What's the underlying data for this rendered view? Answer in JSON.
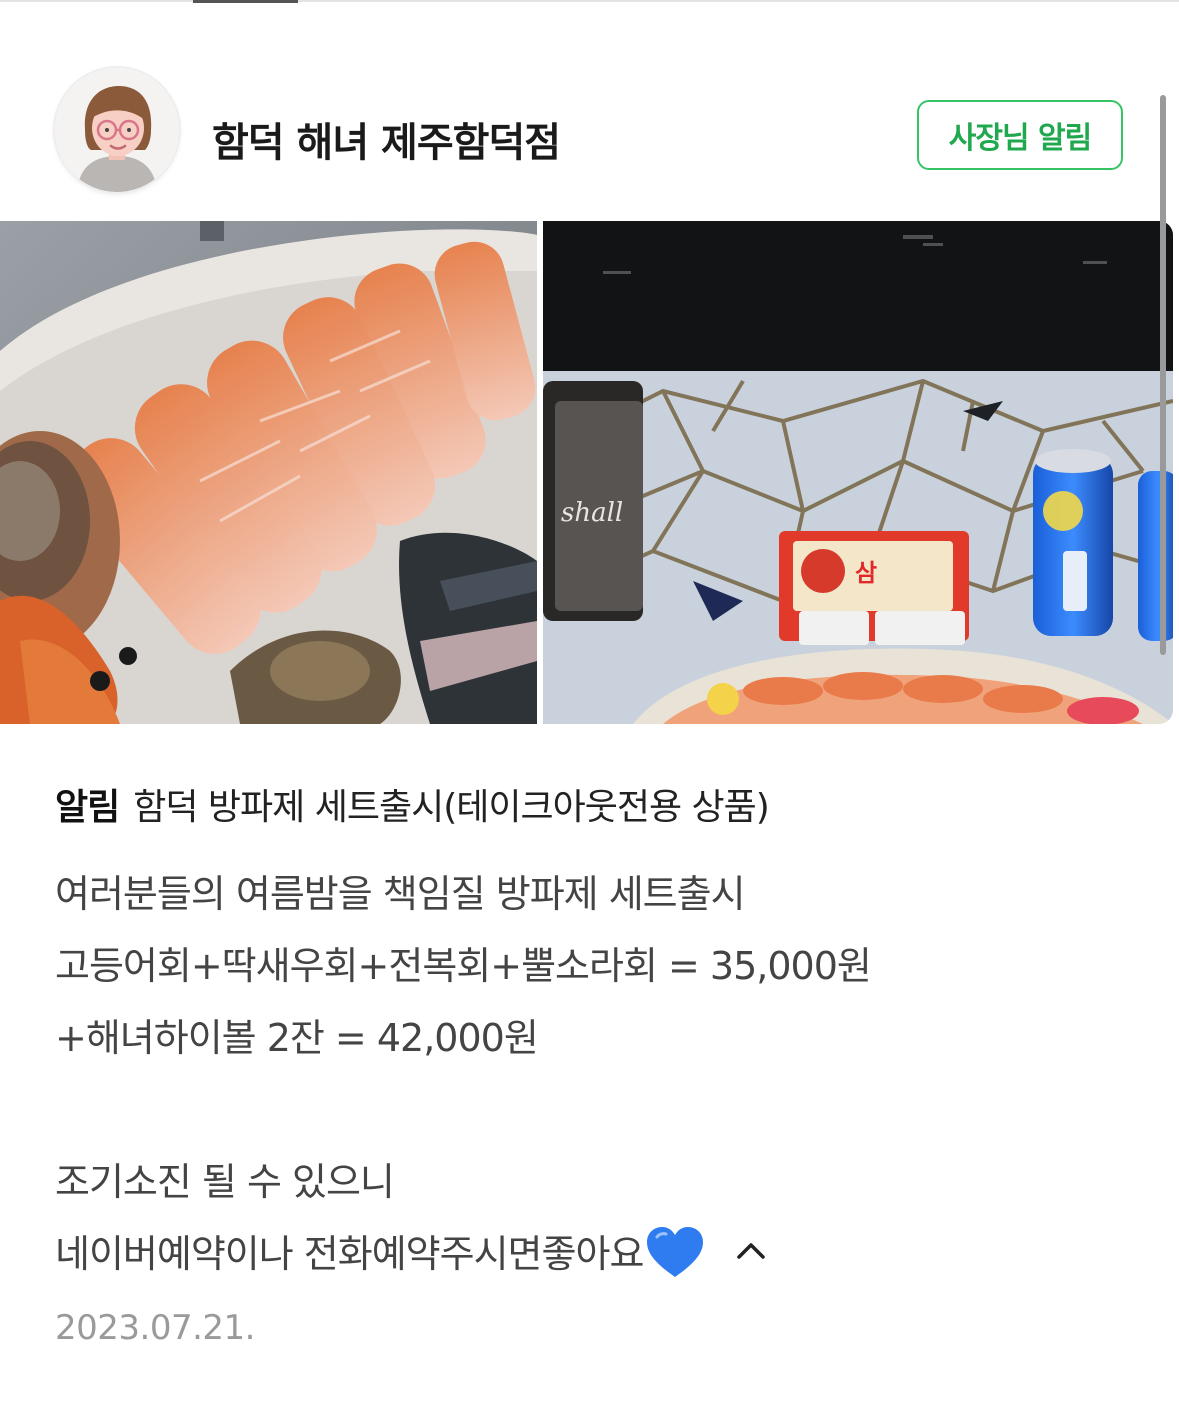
{
  "store": {
    "name": "함덕 해녀 제주함덕점",
    "owner_notice_button": "사장님 알림"
  },
  "gallery": {
    "images": [
      {
        "icon": "seafood-platter-photo"
      },
      {
        "icon": "takeout-set-table-photo"
      }
    ]
  },
  "post": {
    "tag": "알림",
    "title": "함덕 방파제 세트출시(테이크아웃전용 상품)",
    "lines": [
      "여러분들의 여름밤을 책임질 방파제 세트출시",
      "고등어회+딱새우회+전복회+뿔소라회 = 35,000원",
      "+해녀하이볼 2잔 = 42,000원",
      "",
      "조기소진 될 수 있으니",
      "네이버예약이나 전화예약주시면좋아요"
    ],
    "date": "2023.07.21."
  },
  "colors": {
    "accent_green": "#38c266",
    "heart_blue": "#2f7bf0"
  }
}
